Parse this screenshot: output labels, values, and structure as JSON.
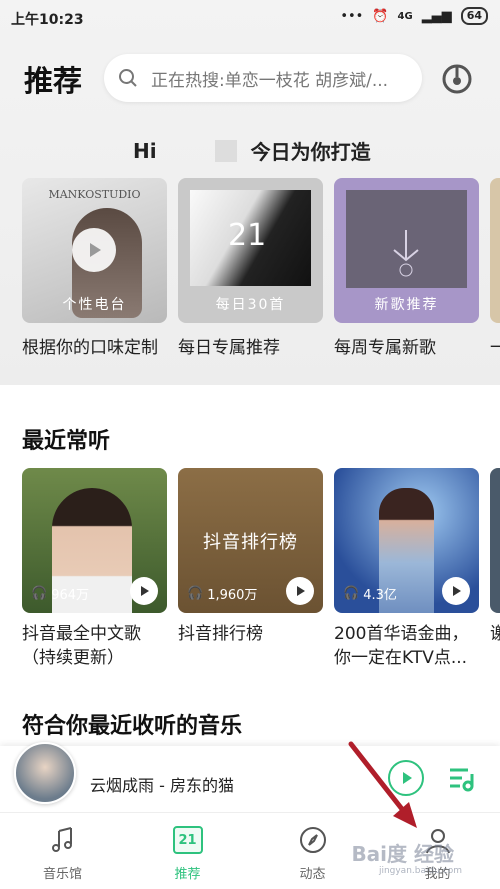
{
  "status": {
    "time": "上午10:23",
    "signal": "4G",
    "battery": "64"
  },
  "header": {
    "title": "推荐",
    "search_placeholder": "正在热搜:单恋一枝花 胡彦斌/..."
  },
  "greeting": {
    "hi": "Hi",
    "suffix": "今日为你打造"
  },
  "daily": [
    {
      "cover_label": "个性电台",
      "title": "根据你的口味定制",
      "cover_text": "MANKOSTUDIO"
    },
    {
      "cover_label": "每日30首",
      "title": "每日专属推荐",
      "cover_text": "21"
    },
    {
      "cover_label": "新歌推荐",
      "title": "每周专属新歌",
      "cover_text": ""
    },
    {
      "cover_label": "",
      "title": "一"
    }
  ],
  "recent": {
    "heading": "最近常听",
    "items": [
      {
        "plays": "964万",
        "title": "抖音最全中文歌（持续更新）",
        "cover_text": ""
      },
      {
        "plays": "1,960万",
        "title": "抖音排行榜",
        "cover_text": "抖音排行榜"
      },
      {
        "plays": "4.3亿",
        "title": "200首华语金曲，你一定在KTV点...",
        "cover_text": ""
      },
      {
        "plays": "",
        "title": "谢"
      }
    ]
  },
  "section3": {
    "heading": "符合你最近收听的音乐"
  },
  "player": {
    "song": "云烟成雨 - 房东的猫"
  },
  "tabs": [
    {
      "label": "音乐馆"
    },
    {
      "label": "推荐",
      "badge": "21"
    },
    {
      "label": "动态"
    },
    {
      "label": "我的"
    }
  ],
  "watermark": {
    "brand": "Bai度 经验",
    "url": "jingyan.baidu.com"
  },
  "colors": {
    "accent": "#2ec27e",
    "arrow": "#b01e2a"
  }
}
